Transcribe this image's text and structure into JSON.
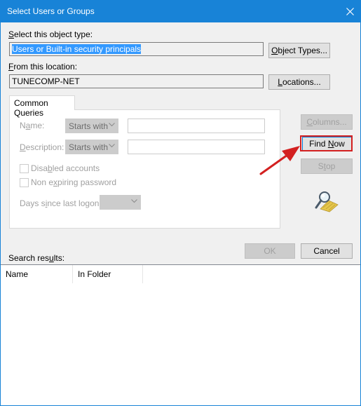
{
  "window": {
    "title": "Select Users or Groups"
  },
  "object_type": {
    "label_u": "S",
    "label_rest": "elect this object type:",
    "value": "Users or Built-in security principals",
    "button_u": "O",
    "button_rest": "bject Types..."
  },
  "location": {
    "label_u": "F",
    "label_rest": "rom this location:",
    "value": "TUNECOMP-NET",
    "button_u": "L",
    "button_rest": "ocations..."
  },
  "queries": {
    "tab_label": "Common Queries",
    "name_label_pre": "N",
    "name_label_u": "a",
    "name_label_post": "me:",
    "name_mode": "Starts with",
    "description_label_u": "D",
    "description_label_post": "escription:",
    "description_mode": "Starts with",
    "disabled_pre": "Disa",
    "disabled_u": "b",
    "disabled_post": "led accounts",
    "nonexpiring_pre": "Non e",
    "nonexpiring_u": "x",
    "nonexpiring_post": "piring password",
    "days_pre": "Days s",
    "days_u": "i",
    "days_post": "nce last logon:"
  },
  "buttons": {
    "columns_u": "C",
    "columns_rest": "olumns...",
    "findnow_pre": "Find ",
    "findnow_u": "N",
    "findnow_post": "ow",
    "stop_pre": "S",
    "stop_u": "t",
    "stop_post": "op",
    "ok": "OK",
    "cancel": "Cancel"
  },
  "results": {
    "label_pre": "Search res",
    "label_u": "u",
    "label_post": "lts:",
    "columns": [
      "Name",
      "In Folder"
    ]
  },
  "colors": {
    "accent": "#1883d7",
    "annotation": "#d32020",
    "selection": "#3399ff"
  }
}
